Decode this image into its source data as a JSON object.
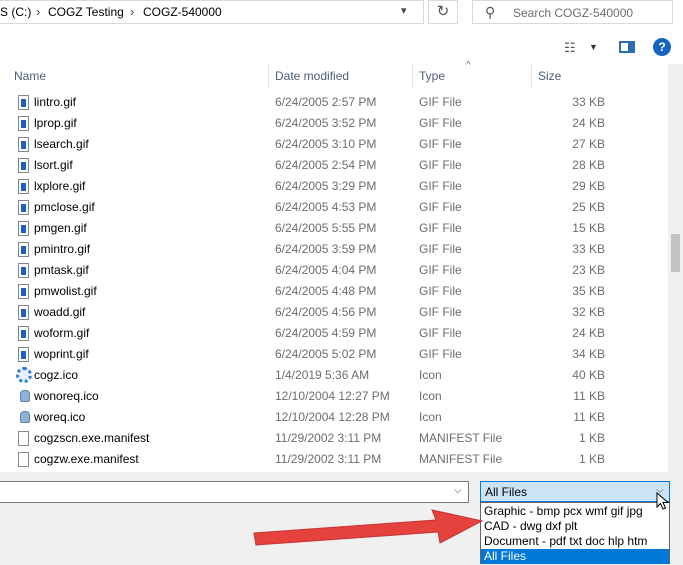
{
  "address_bar": {
    "crumbs": [
      "S (C:)",
      "COGZ Testing",
      "COGZ-540000"
    ]
  },
  "search": {
    "placeholder": "Search COGZ-540000"
  },
  "columns": {
    "name": "Name",
    "date": "Date modified",
    "type": "Type",
    "size": "Size"
  },
  "files": [
    {
      "name": "lintro.gif",
      "date": "6/24/2005 2:57 PM",
      "type": "GIF File",
      "size": "33 KB",
      "icon": "gif-file-icon"
    },
    {
      "name": "lprop.gif",
      "date": "6/24/2005 3:52 PM",
      "type": "GIF File",
      "size": "24 KB",
      "icon": "gif-file-icon"
    },
    {
      "name": "lsearch.gif",
      "date": "6/24/2005 3:10 PM",
      "type": "GIF File",
      "size": "27 KB",
      "icon": "gif-file-icon"
    },
    {
      "name": "lsort.gif",
      "date": "6/24/2005 2:54 PM",
      "type": "GIF File",
      "size": "28 KB",
      "icon": "gif-file-icon"
    },
    {
      "name": "lxplore.gif",
      "date": "6/24/2005 3:29 PM",
      "type": "GIF File",
      "size": "29 KB",
      "icon": "gif-file-icon"
    },
    {
      "name": "pmclose.gif",
      "date": "6/24/2005 4:53 PM",
      "type": "GIF File",
      "size": "25 KB",
      "icon": "gif-file-icon"
    },
    {
      "name": "pmgen.gif",
      "date": "6/24/2005 5:55 PM",
      "type": "GIF File",
      "size": "15 KB",
      "icon": "gif-file-icon"
    },
    {
      "name": "pmintro.gif",
      "date": "6/24/2005 3:59 PM",
      "type": "GIF File",
      "size": "33 KB",
      "icon": "gif-file-icon"
    },
    {
      "name": "pmtask.gif",
      "date": "6/24/2005 4:04 PM",
      "type": "GIF File",
      "size": "23 KB",
      "icon": "gif-file-icon"
    },
    {
      "name": "pmwolist.gif",
      "date": "6/24/2005 4:48 PM",
      "type": "GIF File",
      "size": "35 KB",
      "icon": "gif-file-icon"
    },
    {
      "name": "woadd.gif",
      "date": "6/24/2005 4:56 PM",
      "type": "GIF File",
      "size": "32 KB",
      "icon": "gif-file-icon"
    },
    {
      "name": "woform.gif",
      "date": "6/24/2005 4:59 PM",
      "type": "GIF File",
      "size": "24 KB",
      "icon": "gif-file-icon"
    },
    {
      "name": "woprint.gif",
      "date": "6/24/2005 5:02 PM",
      "type": "GIF File",
      "size": "34 KB",
      "icon": "gif-file-icon"
    },
    {
      "name": "cogz.ico",
      "date": "1/4/2019 5:36 AM",
      "type": "Icon",
      "size": "40 KB",
      "icon": "gear-file-icon"
    },
    {
      "name": "wonoreq.ico",
      "date": "12/10/2004 12:27 PM",
      "type": "Icon",
      "size": "11 KB",
      "icon": "ico-file-icon"
    },
    {
      "name": "woreq.ico",
      "date": "12/10/2004 12:28 PM",
      "type": "Icon",
      "size": "11 KB",
      "icon": "ico-file-icon"
    },
    {
      "name": "cogzscn.exe.manifest",
      "date": "11/29/2002 3:11 PM",
      "type": "MANIFEST File",
      "size": "1 KB",
      "icon": "manifest-file-icon"
    },
    {
      "name": "cogzw.exe.manifest",
      "date": "11/29/2002 3:11 PM",
      "type": "MANIFEST File",
      "size": "1 KB",
      "icon": "manifest-file-icon"
    }
  ],
  "file_type": {
    "selected": "All Files",
    "options": [
      "Graphic - bmp pcx wmf gif jpg",
      "CAD - dwg dxf plt",
      "Document - pdf txt doc hlp htm",
      "All Files"
    ],
    "highlighted_index": 3
  },
  "colors": {
    "accent": "#0078d7",
    "arrow": "#e53935",
    "help": "#1565c0"
  }
}
